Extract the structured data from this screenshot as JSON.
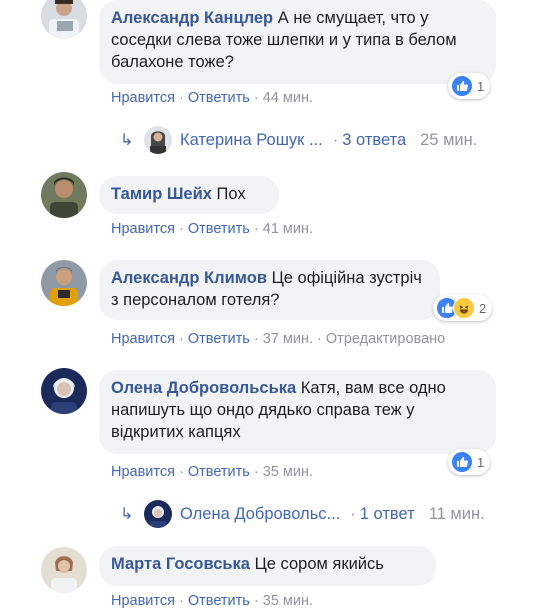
{
  "labels": {
    "like": "Нравится",
    "reply": "Ответить",
    "sep": " · "
  },
  "colors": {
    "link": "#385898",
    "action": "#4267b2",
    "meta": "#90949c",
    "bubble": "#f2f3f5"
  },
  "comments": [
    {
      "author": "Александр Канцлер",
      "text": "А не смущает, что у соседки слева тоже шлепки и у типа в белом балахоне тоже?",
      "time": "44 мин.",
      "reactions": {
        "icons": [
          "like-icon"
        ],
        "count": "1"
      },
      "replies": {
        "name": "Катерина Рошук ...",
        "count": "3 ответа",
        "time": "25 мин."
      }
    },
    {
      "author": "Тамир Шейх",
      "text": "Пох",
      "time": "41 мин."
    },
    {
      "author": "Александр Климов",
      "text": "Це офіційна зустріч з персоналом готеля?",
      "time": "37 мин.",
      "edited": "Отредактировано",
      "reactions": {
        "icons": [
          "like-icon",
          "haha-icon"
        ],
        "count": "2"
      }
    },
    {
      "author": "Олена Добровольська",
      "text": "Катя, вам все одно напишуть що ондо дядько справа теж у відкритих капцях",
      "time": "35 мин.",
      "reactions": {
        "icons": [
          "like-icon"
        ],
        "count": "1"
      },
      "replies": {
        "name": "Олена Добровольс...",
        "count": "1 ответ",
        "time": "11 мин."
      }
    },
    {
      "author": "Марта Госовська",
      "text": "Це сором якийсь",
      "time": "35 мин."
    }
  ]
}
